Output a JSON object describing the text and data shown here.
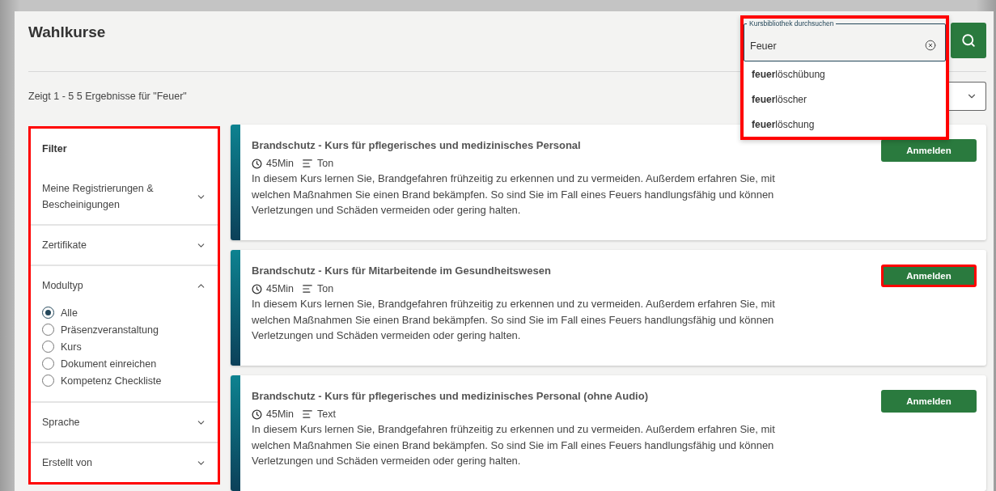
{
  "page": {
    "title": "Wahlkurse"
  },
  "search": {
    "label": "Kursbibliothek durchsuchen",
    "value": "Feuer",
    "highlighted": true,
    "suggestions": [
      "**feuer**löschübung",
      "**feuer**löscher",
      "**feuer**löschung"
    ]
  },
  "results_summary": "Zeigt 1 - 5 5 Ergebnisse für \"Feuer\"",
  "filter": {
    "title": "Filter",
    "highlighted": true,
    "sections": [
      {
        "label": "Meine Registrierungen & Bescheinigungen",
        "expanded": false
      },
      {
        "label": "Zertifikate",
        "expanded": false
      },
      {
        "label": "Modultyp",
        "expanded": true,
        "options": [
          {
            "label": "Alle",
            "selected": true
          },
          {
            "label": "Präsenzveranstaltung",
            "selected": false
          },
          {
            "label": "Kurs",
            "selected": false
          },
          {
            "label": "Dokument einreichen",
            "selected": false
          },
          {
            "label": "Kompetenz Checkliste",
            "selected": false
          }
        ]
      },
      {
        "label": "Sprache",
        "expanded": false
      },
      {
        "label": "Erstellt von",
        "expanded": false
      }
    ]
  },
  "courses": [
    {
      "title": "Brandschutz - Kurs für pflegerisches und medizinisches Personal",
      "duration": "45Min",
      "format": "Ton",
      "description": "In diesem Kurs lernen Sie, Brandgefahren frühzeitig zu erkennen und zu vermeiden. Außerdem erfahren Sie, mit welchen Maßnahmen Sie einen Brand bekämpfen. So sind Sie im Fall eines Feuers handlungsfähig und können Verletzungen und Schäden vermeiden oder gering halten.",
      "button": {
        "label": "Anmelden",
        "highlighted": false
      }
    },
    {
      "title": "Brandschutz - Kurs für Mitarbeitende im Gesundheitswesen",
      "duration": "45Min",
      "format": "Ton",
      "description": "In diesem Kurs lernen Sie, Brandgefahren frühzeitig zu erkennen und zu vermeiden. Außerdem erfahren Sie, mit welchen Maßnahmen Sie einen Brand bekämpfen. So sind Sie im Fall eines Feuers handlungsfähig und können Verletzungen und Schäden vermeiden oder gering halten.",
      "button": {
        "label": "Anmelden",
        "highlighted": true
      }
    },
    {
      "title": "Brandschutz - Kurs für pflegerisches und medizinisches Personal (ohne Audio)",
      "duration": "45Min",
      "format": "Text",
      "description": "In diesem Kurs lernen Sie, Brandgefahren frühzeitig zu erkennen und zu vermeiden. Außerdem erfahren Sie, mit welchen Maßnahmen Sie einen Brand bekämpfen. So sind Sie im Fall eines Feuers handlungsfähig und können Verletzungen und Schäden vermeiden oder gering halten.",
      "button": {
        "label": "Anmelden",
        "highlighted": false
      }
    }
  ]
}
